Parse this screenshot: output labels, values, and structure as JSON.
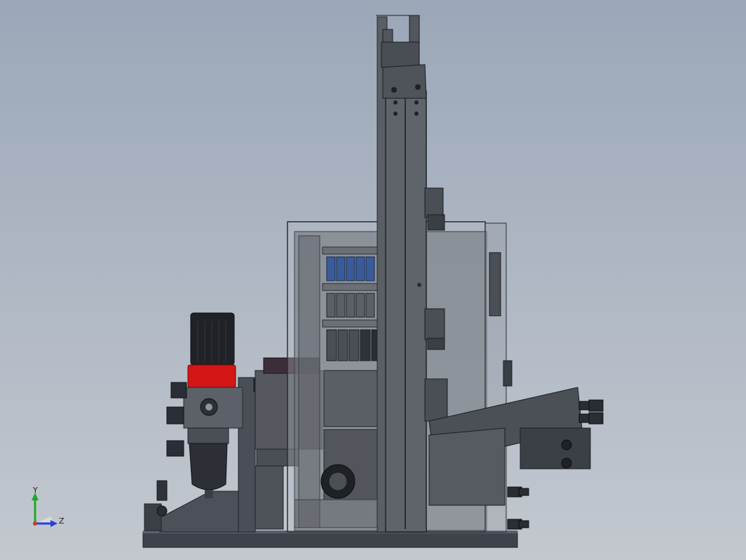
{
  "viewport": {
    "background_top": "#9ba7b8",
    "background_bottom": "#c3c8cf"
  },
  "triad": {
    "y_label": "Y",
    "z_label": "Z",
    "y_color": "#1fa82e",
    "z_color": "#2340d8"
  },
  "model": {
    "regulator_cap_color": "#d41616",
    "enclosure_tint": "rgba(180,186,196,0.35)",
    "terminal_color": "#3a5b9a"
  }
}
